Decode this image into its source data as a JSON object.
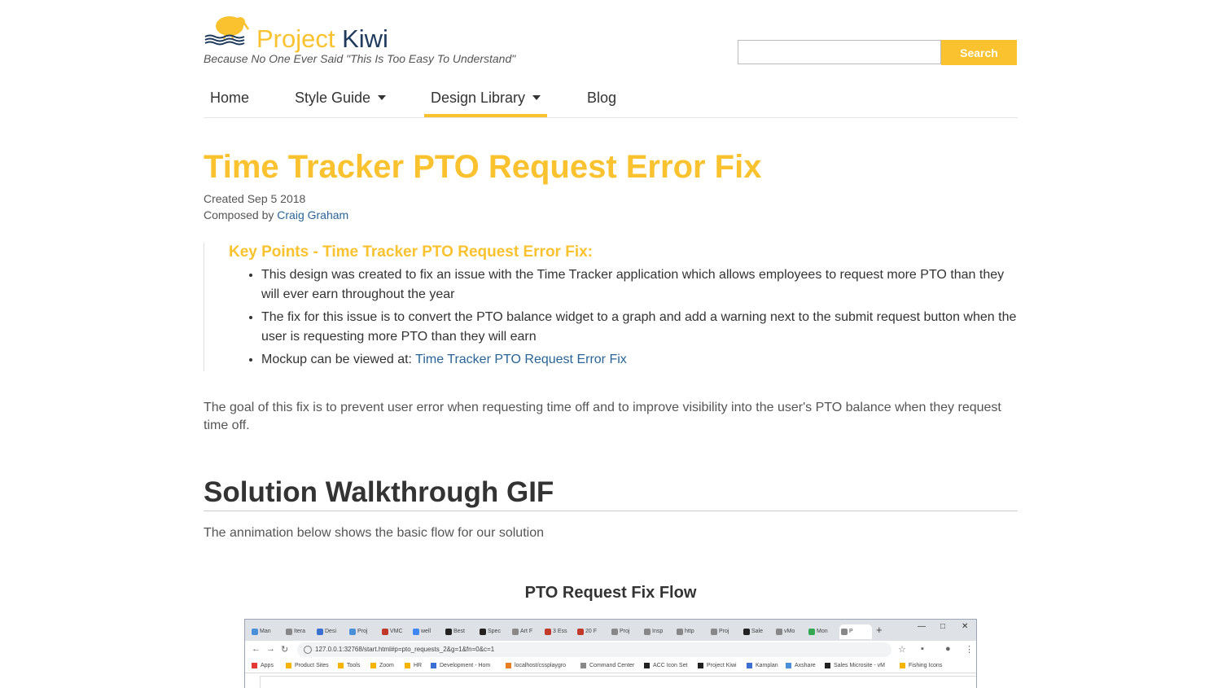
{
  "site": {
    "brand_part1": "Project",
    "brand_part2": "Kiwi",
    "tagline": "Because No One Ever Said \"This Is Too Easy To Understand\"",
    "logo_icon": "kiwi-bird-logo-icon",
    "accent_color": "#f9c22e",
    "link_color": "#2a6496"
  },
  "search": {
    "placeholder": "",
    "value": "",
    "button_label": "Search"
  },
  "nav": {
    "items": [
      {
        "label": "Home",
        "has_dropdown": false,
        "active": false
      },
      {
        "label": "Style Guide",
        "has_dropdown": true,
        "active": false
      },
      {
        "label": "Design Library",
        "has_dropdown": true,
        "active": true
      },
      {
        "label": "Blog",
        "has_dropdown": false,
        "active": false
      }
    ]
  },
  "article": {
    "title": "Time Tracker PTO Request Error Fix",
    "created": "Created Sep 5 2018",
    "composed_prefix": "Composed by ",
    "author": "Craig Graham",
    "key_points": {
      "heading": "Key Points - Time Tracker PTO Request Error Fix:",
      "items": [
        "This design was created to fix an issue with the Time Tracker application which allows employees to request more PTO than they will ever earn throughout the year",
        "The fix for this issue is to convert the PTO balance widget to a graph and add a warning next to the submit request button when the user is requesting more PTO than they will earn"
      ],
      "mockup_prefix": "Mockup can be viewed at: ",
      "mockup_link": "Time Tracker PTO Request Error Fix"
    },
    "goal": "The goal of this fix is to prevent user error when requesting time off and to improve visibility into the user's PTO balance when they request time off.",
    "section_heading": "Solution Walkthrough GIF",
    "section_intro": "The annimation below shows the basic flow for our solution",
    "figure_title": "PTO Request Fix Flow"
  },
  "screenshot": {
    "tabs": [
      {
        "label": "Man",
        "color": "#4a90d9"
      },
      {
        "label": "Itera",
        "color": "#888888"
      },
      {
        "label": "Desi",
        "color": "#3b6fd1"
      },
      {
        "label": "Proj",
        "color": "#4a90d9"
      },
      {
        "label": "VMC",
        "color": "#c0392b"
      },
      {
        "label": "well",
        "color": "#4285f4"
      },
      {
        "label": "Best",
        "color": "#222222"
      },
      {
        "label": "Spec",
        "color": "#222222"
      },
      {
        "label": "Art F",
        "color": "#888888"
      },
      {
        "label": "3 Ess",
        "color": "#c0392b"
      },
      {
        "label": "20 F",
        "color": "#c0392b"
      },
      {
        "label": "Proj",
        "color": "#888888"
      },
      {
        "label": "Insp",
        "color": "#888888"
      },
      {
        "label": "http",
        "color": "#888888"
      },
      {
        "label": "Proj",
        "color": "#888888"
      },
      {
        "label": "Sale",
        "color": "#222222"
      },
      {
        "label": "vMo",
        "color": "#888888"
      },
      {
        "label": "Mon",
        "color": "#34a853"
      },
      {
        "label": "P",
        "color": "#888888"
      }
    ],
    "window_controls": [
      "—",
      "□",
      "✕"
    ],
    "url": "127.0.0.1:32768/start.html#p=pto_requests_2&g=1&fn=0&c=1",
    "bookmarks": [
      {
        "label": "Apps",
        "color": "#e53935"
      },
      {
        "label": "Product Sites",
        "color": "#f4b400"
      },
      {
        "label": "Tools",
        "color": "#f4b400"
      },
      {
        "label": "Zoom",
        "color": "#f4b400"
      },
      {
        "label": "HR",
        "color": "#f4b400"
      },
      {
        "label": "Development - Hom",
        "color": "#3b6fd1"
      },
      {
        "label": "localhost/cssplaygro",
        "color": "#e67e22"
      },
      {
        "label": "Command Center",
        "color": "#888888"
      },
      {
        "label": "ACC Icon Set",
        "color": "#222222"
      },
      {
        "label": "Project Kiwi",
        "color": "#222222"
      },
      {
        "label": "Kamplan",
        "color": "#3b6fd1"
      },
      {
        "label": "Axshare",
        "color": "#4a90d9"
      },
      {
        "label": "Sales Microsite - vM",
        "color": "#222222"
      },
      {
        "label": "Fishing Icons",
        "color": "#f4b400"
      }
    ]
  }
}
